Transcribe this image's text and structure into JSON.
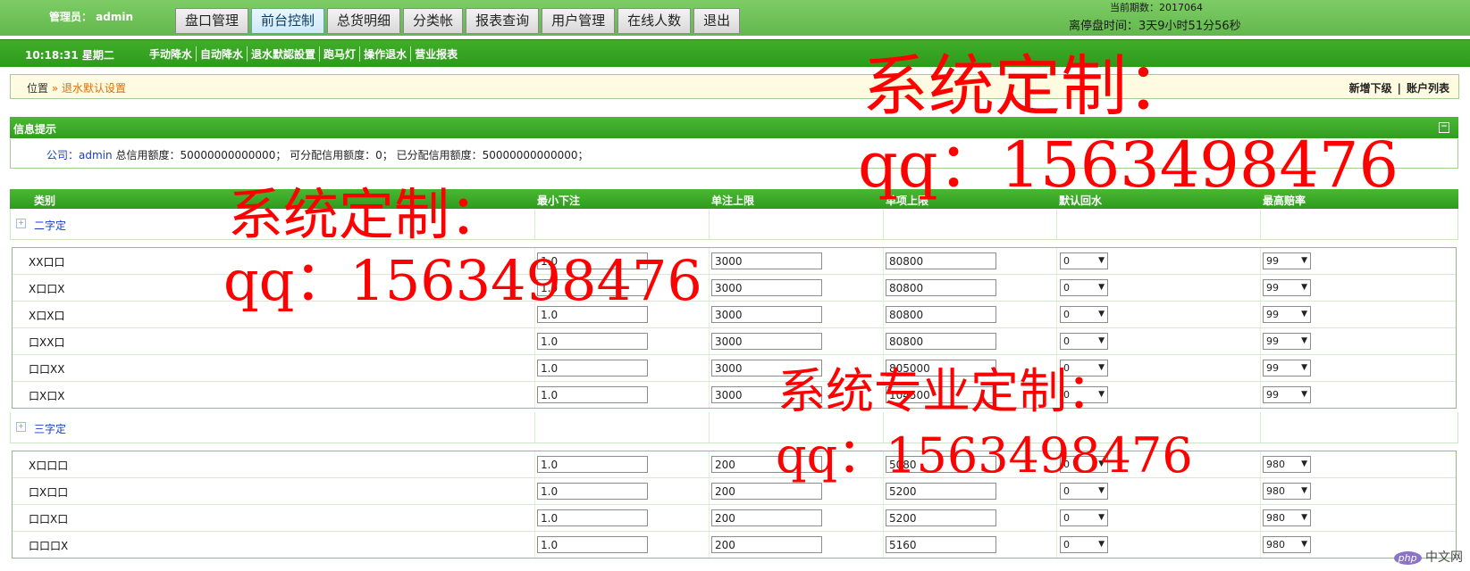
{
  "header": {
    "admin_label": "管理员： admin",
    "nav_tabs": [
      "盘口管理",
      "前台控制",
      "总货明细",
      "分类帐",
      "报表查询",
      "用户管理",
      "在线人数",
      "退出"
    ],
    "active_tab": "前台控制",
    "period_label": "当前期数：2017064",
    "time_left": "离停盘时间：3天9小时51分56秒"
  },
  "subnav": {
    "clock": "10:18:31 星期二",
    "items": [
      "手动降水",
      "自动降水",
      "退水默認設置",
      "跑马灯",
      "操作退水",
      "营业报表"
    ]
  },
  "breadcrumb": {
    "pos": "位置",
    "sep": " » ",
    "current": "退水默认设置",
    "links": [
      "新增下级",
      "账户列表"
    ],
    "link_sep": "|"
  },
  "info": {
    "title": "信息提示",
    "company_label": "公司：",
    "company_value": "admin",
    "text": " 总信用额度：50000000000000； 可分配信用额度：0； 已分配信用额度：50000000000000；"
  },
  "table": {
    "headers": [
      "类别",
      "最小下注",
      "单注上限",
      "单项上限",
      "默认回水",
      "最高赔率"
    ],
    "groups": [
      {
        "label": "二字定",
        "rows": [
          {
            "name": "XX口口",
            "min": "1.0",
            "single": "3000",
            "item": "80800",
            "rebate": "0",
            "odds": "99"
          },
          {
            "name": "X口口X",
            "min": "1.0",
            "single": "3000",
            "item": "80800",
            "rebate": "0",
            "odds": "99"
          },
          {
            "name": "X口X口",
            "min": "1.0",
            "single": "3000",
            "item": "80800",
            "rebate": "0",
            "odds": "99"
          },
          {
            "name": "口XX口",
            "min": "1.0",
            "single": "3000",
            "item": "80800",
            "rebate": "0",
            "odds": "99"
          },
          {
            "name": "口口XX",
            "min": "1.0",
            "single": "3000",
            "item": "805000",
            "rebate": "0",
            "odds": "99"
          },
          {
            "name": "口X口X",
            "min": "1.0",
            "single": "3000",
            "item": "104500",
            "rebate": "0",
            "odds": "99"
          }
        ]
      },
      {
        "label": "三字定",
        "rows": [
          {
            "name": "X口口口",
            "min": "1.0",
            "single": "200",
            "item": "5080",
            "rebate": "0",
            "odds": "980"
          },
          {
            "name": "口X口口",
            "min": "1.0",
            "single": "200",
            "item": "5200",
            "rebate": "0",
            "odds": "980"
          },
          {
            "name": "口口X口",
            "min": "1.0",
            "single": "200",
            "item": "5200",
            "rebate": "0",
            "odds": "980"
          },
          {
            "name": "口口口X",
            "min": "1.0",
            "single": "200",
            "item": "5160",
            "rebate": "0",
            "odds": "980"
          }
        ]
      }
    ]
  },
  "watermarks": [
    {
      "line1": "系统定制：",
      "line2": "qq：1563498476"
    },
    {
      "line1": "系统定制：",
      "line2": "qq：1563498476"
    },
    {
      "line1": "系统专业定制：",
      "line2": "qq：1563498476"
    }
  ],
  "logo": {
    "badge": "php",
    "text": "中文网"
  },
  "colors": {
    "header": "#62b84c",
    "subnav": "#2e9a1c",
    "watermark": "#ff0000",
    "link": "#1a3cc7",
    "crumb": "#e06d00"
  }
}
